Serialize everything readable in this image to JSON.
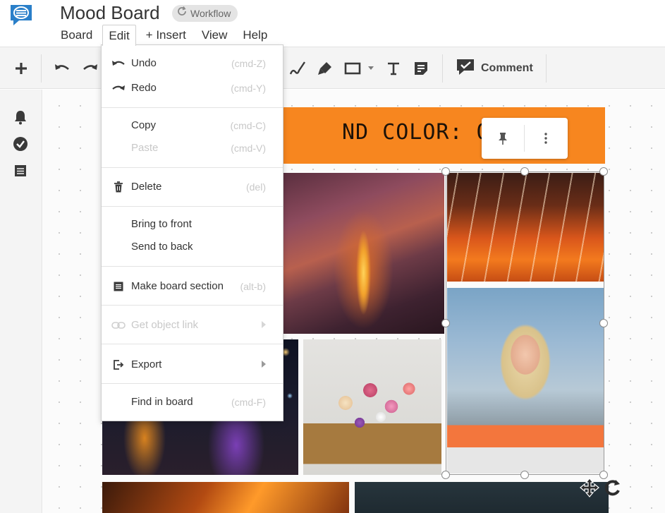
{
  "header": {
    "title": "Mood Board",
    "workflow_label": "Workflow",
    "brand_color": "#2a7fc9"
  },
  "menubar": {
    "items": [
      "Board",
      "Edit",
      "+ Insert",
      "View",
      "Help"
    ],
    "active": "Edit"
  },
  "toolbar": {
    "comment_label": "Comment",
    "tools": [
      "add-icon",
      "undo-icon",
      "redo-icon",
      "pen-icon",
      "highlighter-icon",
      "rectangle-icon",
      "shape-dropdown-icon",
      "text-icon",
      "sticky-note-icon",
      "comment-icon"
    ]
  },
  "left_rail": {
    "icons": [
      "bell-icon",
      "checkmark-circle-icon",
      "list-icon"
    ]
  },
  "canvas": {
    "section_title": "ND COLOR: ORANGE",
    "section_color": "#f7861f",
    "photos": [
      "canyon-photo",
      "hallway-photo",
      "woman-photo",
      "bokeh-photo",
      "flowers-photo",
      "fire-photo",
      "dark-photo"
    ]
  },
  "edit_menu": {
    "undo": {
      "label": "Undo",
      "shortcut": "(cmd-Z)"
    },
    "redo": {
      "label": "Redo",
      "shortcut": "(cmd-Y)"
    },
    "copy": {
      "label": "Copy",
      "shortcut": "(cmd-C)"
    },
    "paste": {
      "label": "Paste",
      "shortcut": "(cmd-V)",
      "disabled": true
    },
    "delete": {
      "label": "Delete",
      "shortcut": "(del)"
    },
    "bring_to_front": {
      "label": "Bring to front"
    },
    "send_to_back": {
      "label": "Send to back"
    },
    "make_section": {
      "label": "Make board section",
      "shortcut": "(alt-b)"
    },
    "object_link": {
      "label": "Get object link",
      "disabled": true
    },
    "export": {
      "label": "Export"
    },
    "find": {
      "label": "Find in board",
      "shortcut": "(cmd-F)"
    }
  }
}
